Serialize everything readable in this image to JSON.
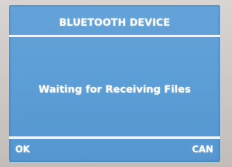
{
  "screen": {
    "title": "BLUETOOTH DEVICE",
    "message": "Waiting for Receiving Files"
  },
  "softkeys": {
    "left_label": "OK",
    "right_label": "CAN"
  },
  "colors": {
    "screen_background": "#5c9ed6",
    "text": "#ffffff",
    "divider": "#f4f9ff"
  }
}
